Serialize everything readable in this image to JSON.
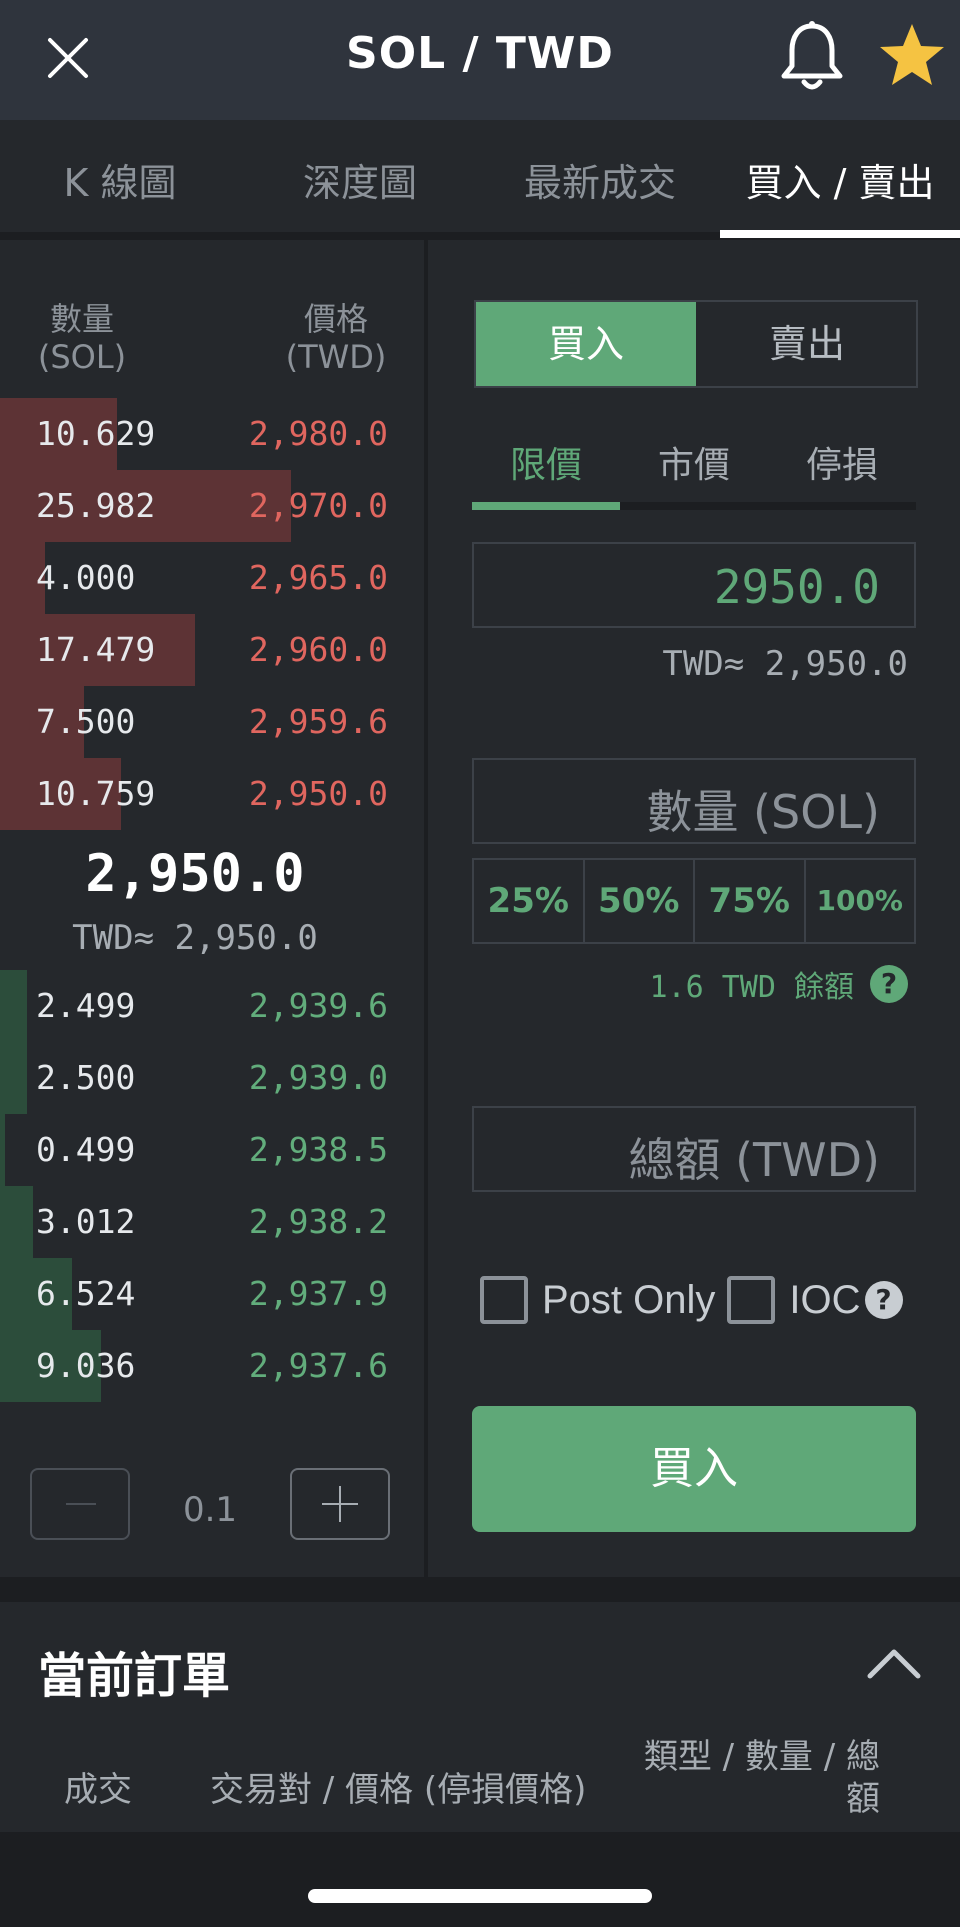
{
  "header": {
    "title": "SOL / TWD",
    "close_icon": "close-icon",
    "bell_icon": "bell-icon",
    "star_icon": "star-icon",
    "star_color": "#f5c342"
  },
  "tabs": [
    {
      "label": "K 線圖"
    },
    {
      "label": "深度圖"
    },
    {
      "label": "最新成交"
    },
    {
      "label": "買入 / 賣出",
      "active": true
    }
  ],
  "order_book": {
    "qty_header_line1": "數量",
    "qty_header_line2": "(SOL)",
    "price_header_line1": "價格",
    "price_header_line2": "(TWD)",
    "asks": [
      {
        "qty": "10.629",
        "price": "2,980.0",
        "depth": 0.3
      },
      {
        "qty": "25.982",
        "price": "2,970.0",
        "depth": 0.745
      },
      {
        "qty": "4.000",
        "price": "2,965.0",
        "depth": 0.115
      },
      {
        "qty": "17.479",
        "price": "2,960.0",
        "depth": 0.5
      },
      {
        "qty": "7.500",
        "price": "2,959.6",
        "depth": 0.215
      },
      {
        "qty": "10.759",
        "price": "2,950.0",
        "depth": 0.31
      }
    ],
    "mid_price": "2,950.0",
    "mid_twd": "TWD≈ 2,950.0",
    "bids": [
      {
        "qty": "2.499",
        "price": "2,939.6",
        "depth": 0.07
      },
      {
        "qty": "2.500",
        "price": "2,939.0",
        "depth": 0.07
      },
      {
        "qty": "0.499",
        "price": "2,938.5",
        "depth": 0.014
      },
      {
        "qty": "3.012",
        "price": "2,938.2",
        "depth": 0.085
      },
      {
        "qty": "6.524",
        "price": "2,937.9",
        "depth": 0.185
      },
      {
        "qty": "9.036",
        "price": "2,937.6",
        "depth": 0.26
      }
    ],
    "step_minus": "−",
    "step_value": "0.1",
    "step_plus": "+"
  },
  "trade_form": {
    "buy_label": "買入",
    "sell_label": "賣出",
    "order_types": [
      "限價",
      "市價",
      "停損"
    ],
    "price_value": "2950.0",
    "price_twd": "TWD≈ 2,950.0",
    "amount_placeholder": "數量 (SOL)",
    "percents": [
      "25%",
      "50%",
      "75%",
      "100%"
    ],
    "balance_text": "1.6 TWD 餘額",
    "balance_help_icon": "help-icon",
    "total_placeholder": "總額 (TWD)",
    "post_only_label": "Post Only",
    "ioc_label": "IOC",
    "submit_label": "買入",
    "accent_color": "#5fa878"
  },
  "orders": {
    "title": "當前訂單",
    "col_filled": "成交",
    "col_pair": "交易對 / 價格 (停損價格)",
    "col_type_line1": "類型 / 數量 / 總",
    "col_type_line2": "額"
  }
}
